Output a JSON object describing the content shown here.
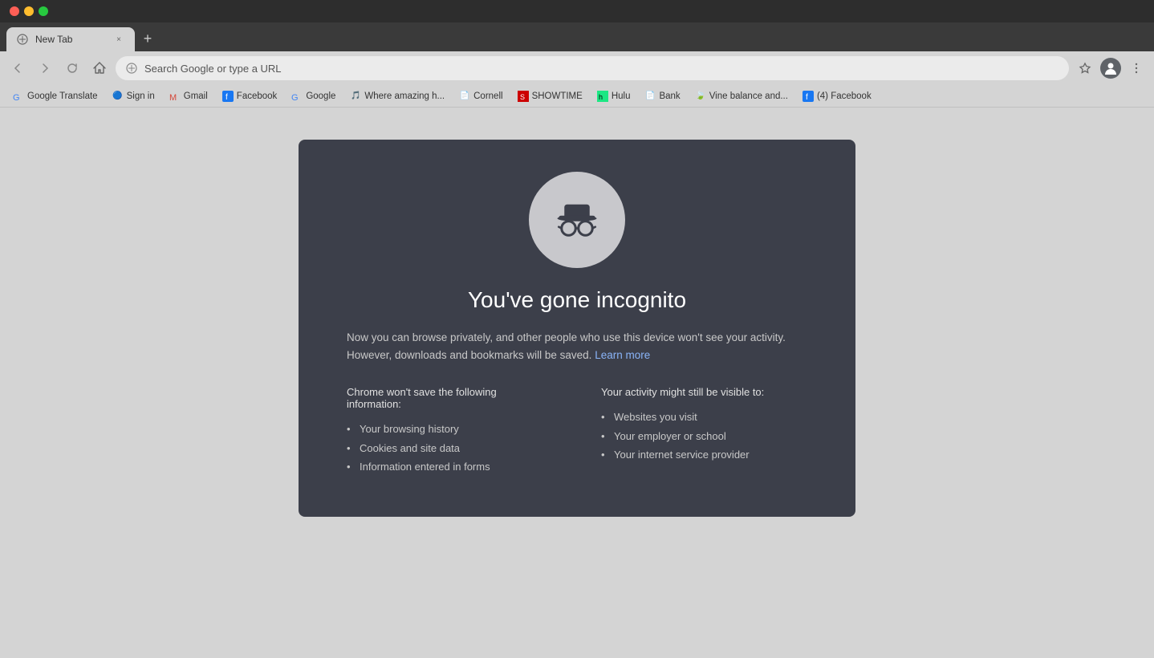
{
  "titlebar": {
    "lights": [
      "close",
      "minimize",
      "maximize"
    ]
  },
  "tab": {
    "title": "New Tab",
    "close_label": "×",
    "new_tab_label": "+"
  },
  "navbar": {
    "back_label": "‹",
    "forward_label": "›",
    "refresh_label": "↻",
    "home_label": "⌂",
    "address_placeholder": "Search Google or type a URL",
    "address_value": "Search Google or type a URL",
    "star_label": "☆",
    "profile_label": "Incognit...",
    "menu_label": "⋮"
  },
  "bookmarks": [
    {
      "label": "Google Translate",
      "icon": "G"
    },
    {
      "label": "Sign in",
      "icon": "🔵"
    },
    {
      "label": "Gmail",
      "icon": "M"
    },
    {
      "label": "Facebook",
      "icon": "f"
    },
    {
      "label": "Google",
      "icon": "G"
    },
    {
      "label": "Where amazing h...",
      "icon": "🎵"
    },
    {
      "label": "Cornell",
      "icon": "📄"
    },
    {
      "label": "SHOWTIME",
      "icon": "S"
    },
    {
      "label": "Hulu",
      "icon": "h"
    },
    {
      "label": "Bank",
      "icon": "📄"
    },
    {
      "label": "Vine balance and...",
      "icon": "🍃"
    },
    {
      "label": "(4) Facebook",
      "icon": "f"
    }
  ],
  "incognito": {
    "title": "You've gone incognito",
    "description": "Now you can browse privately, and other people who use this device won't see your activity. However, downloads and bookmarks will be saved.",
    "learn_more_label": "Learn more",
    "section_left_title": "Chrome won't save the following information:",
    "section_right_title": "Your activity might still be visible to:",
    "left_items": [
      "Your browsing history",
      "Cookies and site data",
      "Information entered in forms"
    ],
    "right_items": [
      "Websites you visit",
      "Your employer or school",
      "Your internet service provider"
    ]
  }
}
